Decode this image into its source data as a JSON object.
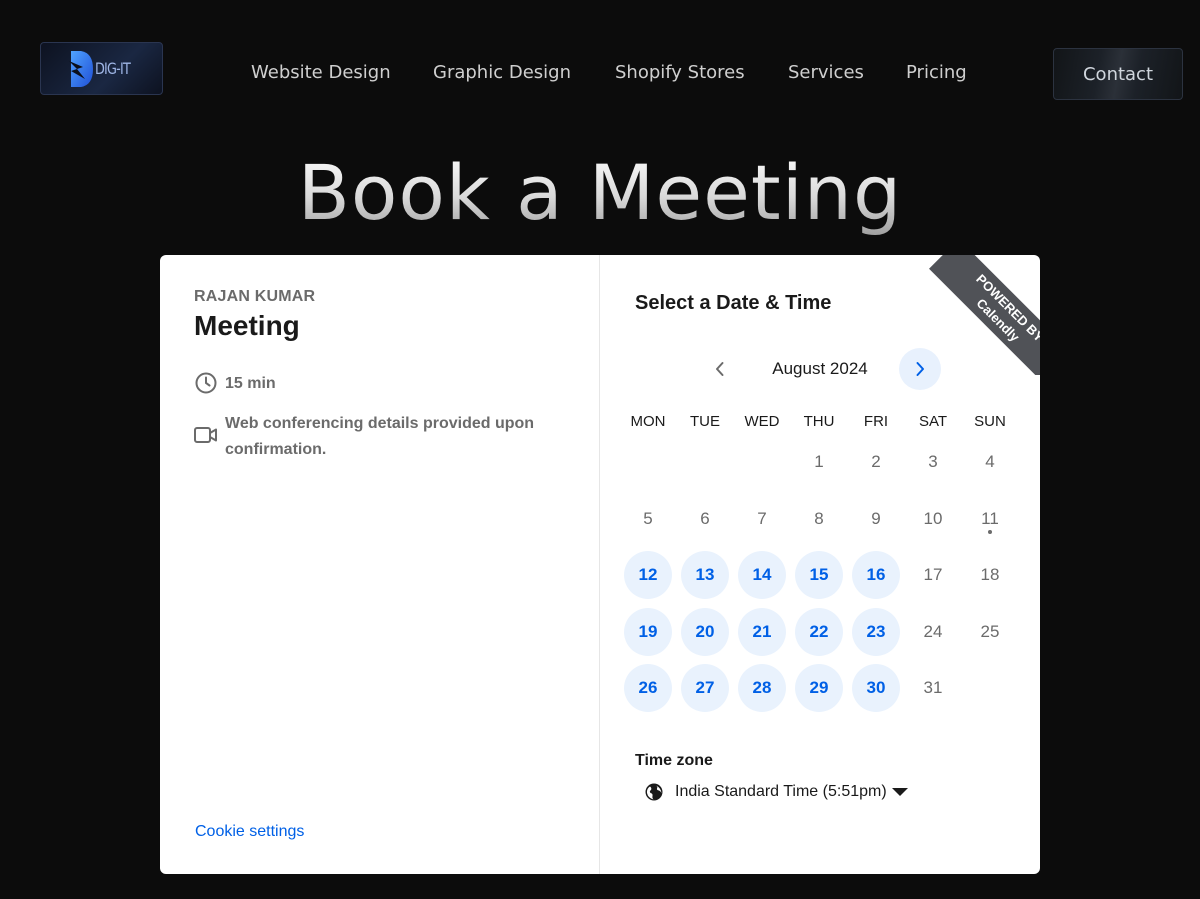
{
  "header": {
    "logo_text": "DIG-IT",
    "nav": [
      "Website Design",
      "Graphic Design",
      "Shopify Stores",
      "Services",
      "Pricing"
    ],
    "contact_label": "Contact"
  },
  "page_title": "Book a Meeting",
  "widget": {
    "organizer": "RAJAN KUMAR",
    "event_name": "Meeting",
    "duration": "15 min",
    "location": "Web conferencing details provided upon confirmation.",
    "cookie_settings": "Cookie settings",
    "select_title": "Select a Date & Time",
    "month": "August 2024",
    "weekdays": [
      "MON",
      "TUE",
      "WED",
      "THU",
      "FRI",
      "SAT",
      "SUN"
    ],
    "weeks": [
      [
        "",
        "",
        "",
        "1",
        "2",
        "3",
        "4"
      ],
      [
        "5",
        "6",
        "7",
        "8",
        "9",
        "10",
        "11"
      ],
      [
        "12",
        "13",
        "14",
        "15",
        "16",
        "17",
        "18"
      ],
      [
        "19",
        "20",
        "21",
        "22",
        "23",
        "24",
        "25"
      ],
      [
        "26",
        "27",
        "28",
        "29",
        "30",
        "31",
        ""
      ]
    ],
    "available_days": [
      "12",
      "13",
      "14",
      "15",
      "16",
      "19",
      "20",
      "21",
      "22",
      "23",
      "26",
      "27",
      "28",
      "29",
      "30"
    ],
    "today": "11",
    "timezone_label": "Time zone",
    "timezone_value": "India Standard Time (5:51pm)",
    "ribbon_line1": "POWERED BY",
    "ribbon_line2": "Calendly"
  },
  "colors": {
    "accent": "#0060e6",
    "available_bg": "#e9f2fd",
    "page_bg": "#0c0c0c"
  },
  "icons": [
    "logo-bolt-icon",
    "clock-icon",
    "video-camera-icon",
    "chevron-left-icon",
    "chevron-right-icon",
    "globe-icon",
    "caret-down-icon"
  ]
}
